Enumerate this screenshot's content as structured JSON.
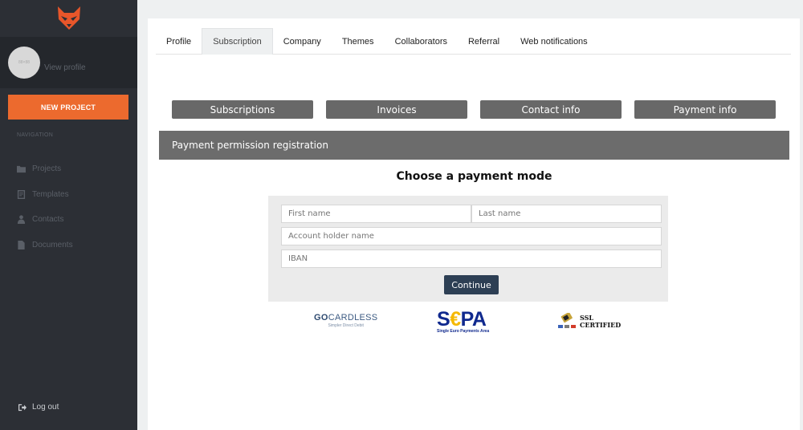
{
  "sidebar": {
    "avatar_text": "88×88",
    "view_profile": "View profile",
    "new_project": "NEW PROJECT",
    "nav_label": "NAVIGATION",
    "items": [
      {
        "label": "Projects",
        "icon": "folder-icon"
      },
      {
        "label": "Templates",
        "icon": "template-icon"
      },
      {
        "label": "Contacts",
        "icon": "user-icon"
      },
      {
        "label": "Documents",
        "icon": "document-icon"
      }
    ],
    "logout": "Log out"
  },
  "tabs": [
    {
      "label": "Profile",
      "active": false
    },
    {
      "label": "Subscription",
      "active": true
    },
    {
      "label": "Company",
      "active": false
    },
    {
      "label": "Themes",
      "active": false
    },
    {
      "label": "Collaborators",
      "active": false
    },
    {
      "label": "Referral",
      "active": false
    },
    {
      "label": "Web notifications",
      "active": false
    }
  ],
  "subnav": [
    "Subscriptions",
    "Invoices",
    "Contact info",
    "Payment info"
  ],
  "section_title": "Payment permission registration",
  "choose_title": "Choose a payment mode",
  "form": {
    "first_name_placeholder": "First name",
    "last_name_placeholder": "Last name",
    "account_holder_placeholder": "Account holder name",
    "iban_placeholder": "IBAN",
    "continue": "Continue"
  },
  "logos": {
    "gocardless_go": "GO",
    "gocardless_rest": "CARDLESS",
    "gocardless_sub": "Simpler Direct Debit",
    "sepa_s": "S",
    "sepa_e": "€",
    "sepa_pa": "PA",
    "sepa_sub": "Single Euro Payments Area",
    "ssl_line1": "SSL",
    "ssl_line2": "CERTIFIED"
  },
  "colors": {
    "accent": "#ec6a2e",
    "sidebar": "#2c2f35",
    "primary_button": "#2d3f54"
  }
}
